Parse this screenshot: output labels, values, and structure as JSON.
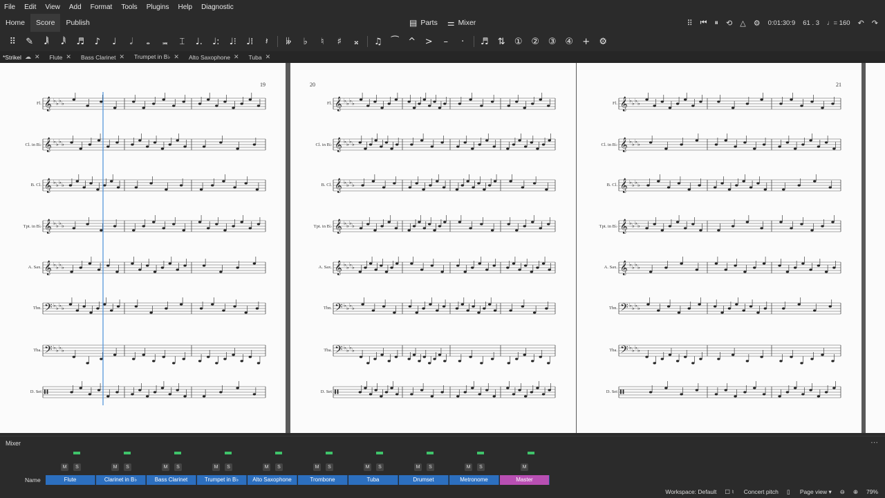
{
  "menu": [
    "File",
    "Edit",
    "View",
    "Add",
    "Format",
    "Tools",
    "Plugins",
    "Help",
    "Diagnostic"
  ],
  "top_tabs": [
    "Home",
    "Score",
    "Publish"
  ],
  "center": {
    "parts": "Parts",
    "mixer": "Mixer"
  },
  "playback": {
    "time": "0:01:30:9",
    "position": "61 . 3",
    "tempo": "♩= 160"
  },
  "doc_tabs": [
    {
      "label": "*Strikel",
      "active": true
    },
    {
      "label": "Flute"
    },
    {
      "label": "Bass Clarinet"
    },
    {
      "label": "Trumpet in B♭"
    },
    {
      "label": "Alto Saxophone"
    },
    {
      "label": "Tuba"
    }
  ],
  "pages": [
    {
      "number": "19"
    },
    {
      "number": "20"
    },
    {
      "number": "21"
    }
  ],
  "instruments": [
    "Fl.",
    "Cl. in B♭",
    "B. Cl.",
    "Tpt. in B♭",
    "A. Sax.",
    "Tbn.",
    "Tba.",
    "D. Set"
  ],
  "mixer": {
    "title": "Mixer",
    "name_label": "Name",
    "mute": "M",
    "solo": "S",
    "channels": [
      "Flute",
      "Clarinet in B♭",
      "Bass Clarinet",
      "Trumpet in B♭",
      "Alto Saxophone",
      "Trombone",
      "Tuba",
      "Drumset",
      "Metronome",
      "Master"
    ]
  },
  "status": {
    "workspace": "Workspace: Default",
    "concert_pitch": "Concert pitch",
    "page_view": "Page view",
    "zoom": "79%"
  }
}
